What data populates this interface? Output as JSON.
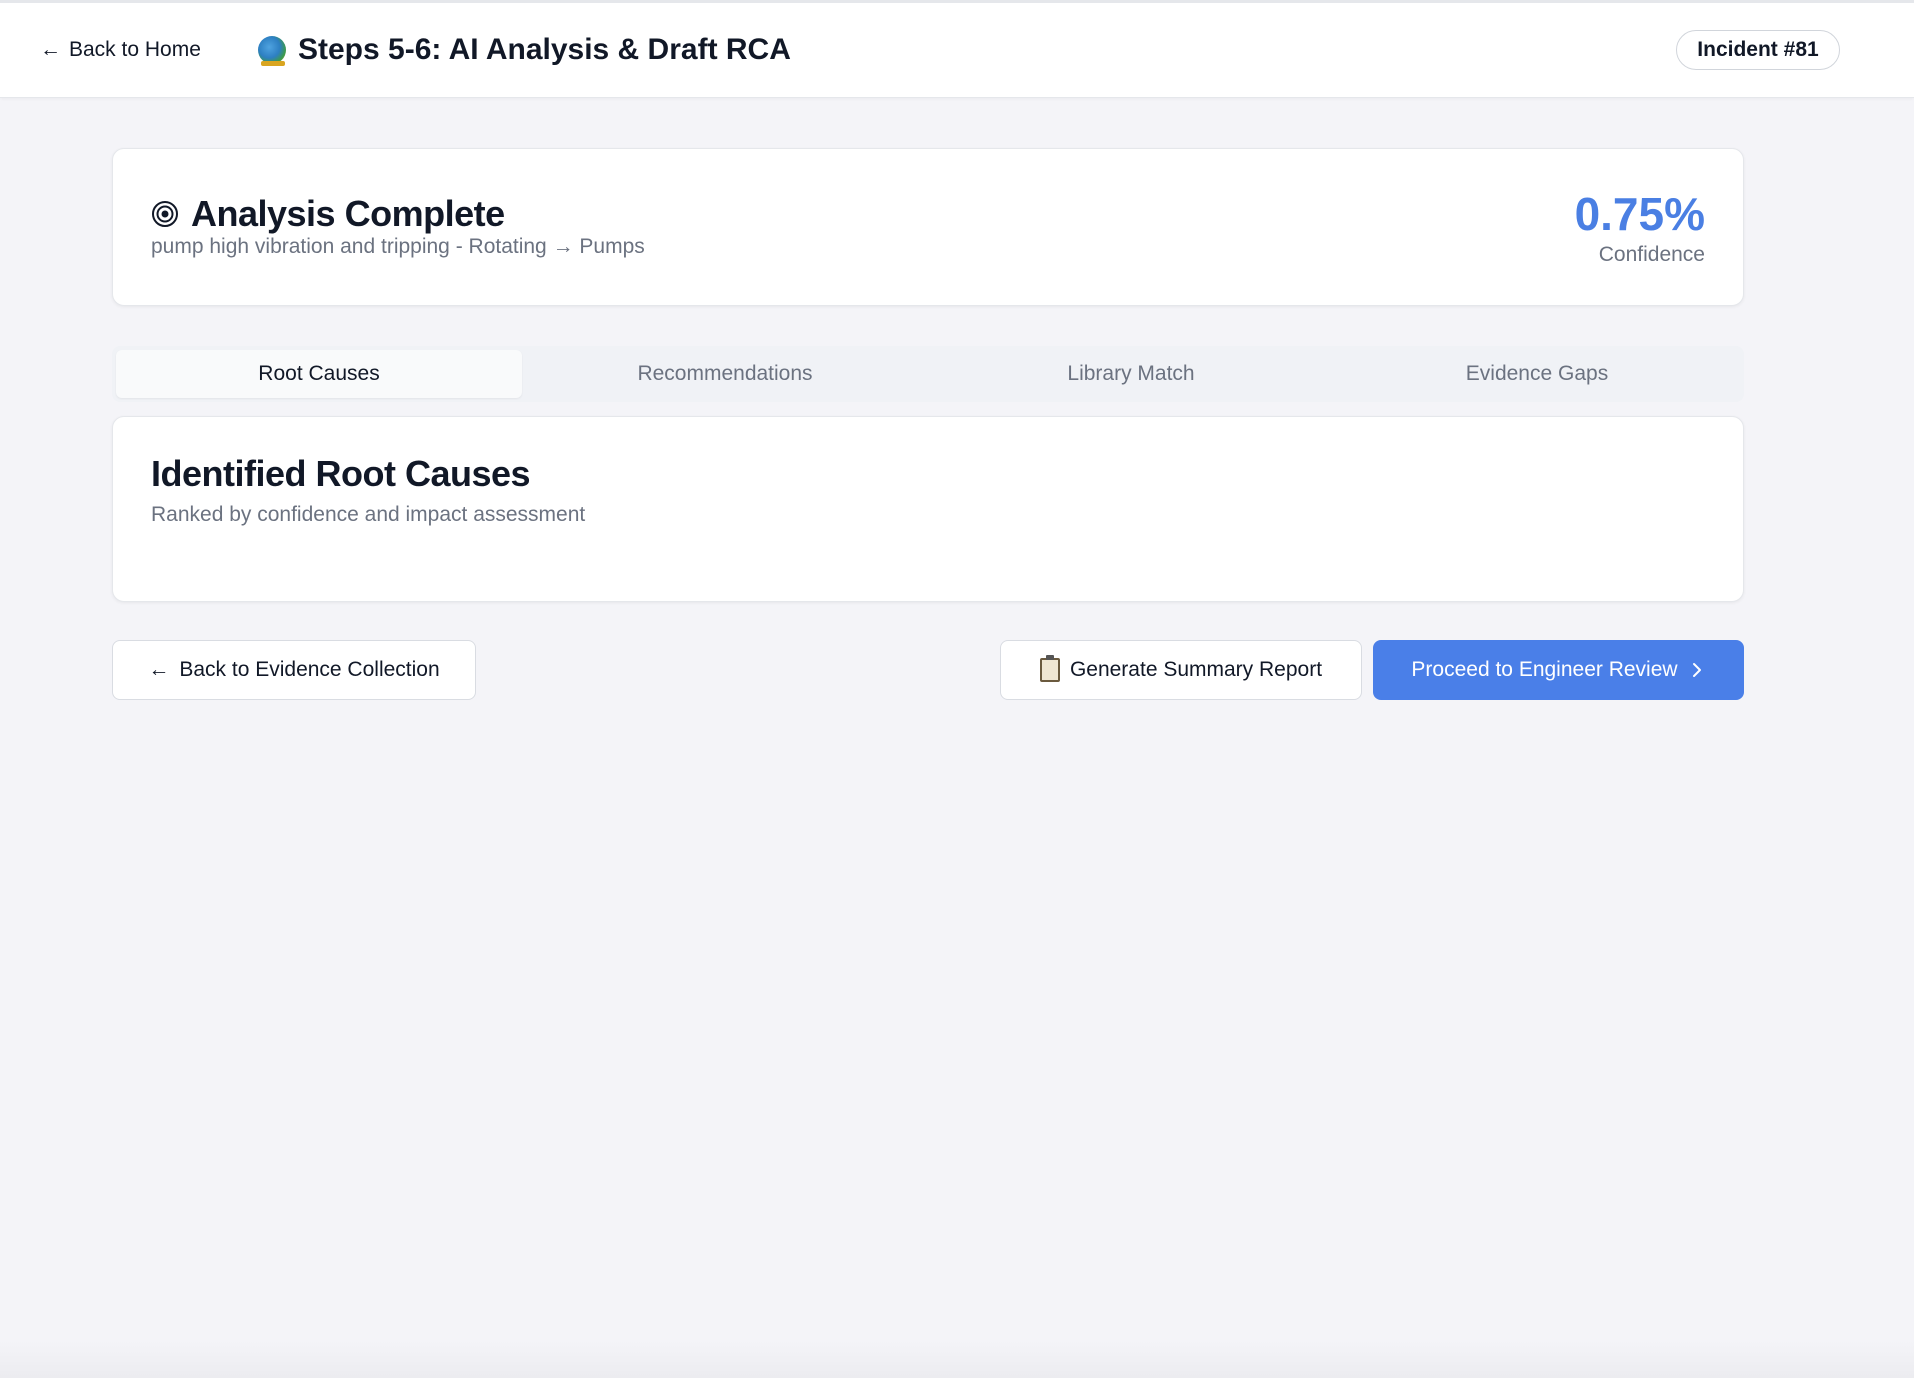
{
  "header": {
    "back_label": "Back to Home",
    "title": "Steps 5-6: AI Analysis & Draft RCA",
    "incident_badge": "Incident #81"
  },
  "summary": {
    "title": "Analysis Complete",
    "subtitle": "pump high vibration and tripping - Rotating → Pumps",
    "confidence_value": "0.75%",
    "confidence_label": "Confidence"
  },
  "tabs": [
    {
      "label": "Root Causes",
      "active": true
    },
    {
      "label": "Recommendations",
      "active": false
    },
    {
      "label": "Library Match",
      "active": false
    },
    {
      "label": "Evidence Gaps",
      "active": false
    }
  ],
  "root_causes": {
    "title": "Identified Root Causes",
    "subtitle": "Ranked by confidence and impact assessment"
  },
  "actions": {
    "back_label": "Back to Evidence Collection",
    "report_label": "Generate Summary Report",
    "proceed_label": "Proceed to Engineer Review"
  },
  "colors": {
    "accent": "#4a7fe8",
    "confidence": "#4a7fe3",
    "muted_text": "#6b7280"
  }
}
